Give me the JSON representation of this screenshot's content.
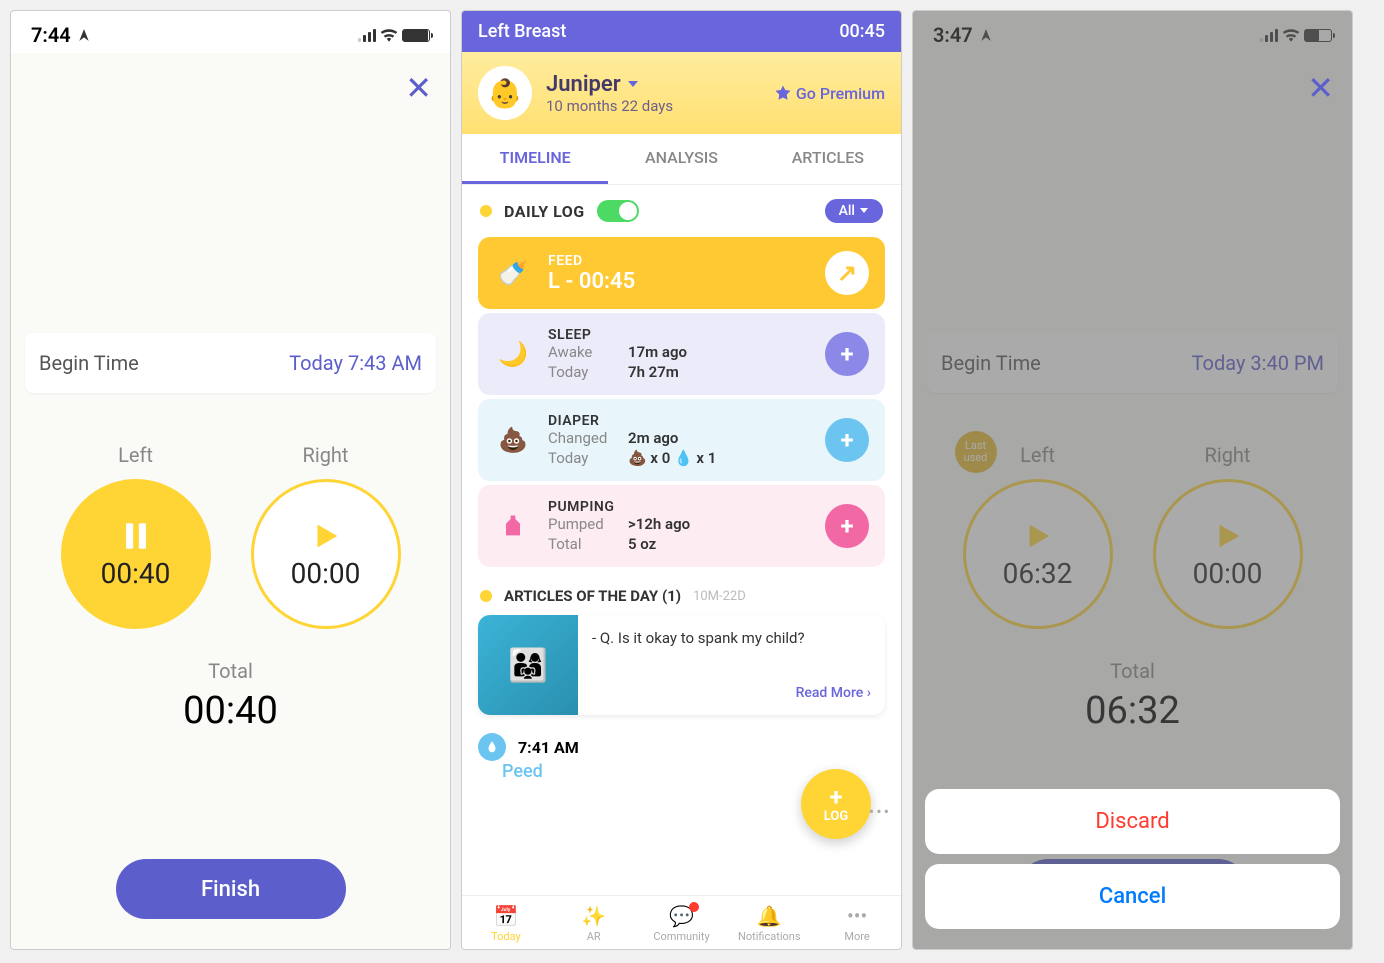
{
  "phone1": {
    "status_time": "7:44",
    "begin_label": "Begin Time",
    "begin_value": "Today 7:43 AM",
    "left_label": "Left",
    "right_label": "Right",
    "left_time": "00:40",
    "right_time": "00:00",
    "total_label": "Total",
    "total_time": "00:40",
    "finish": "Finish"
  },
  "phone2": {
    "header_title": "Left Breast",
    "header_time": "00:45",
    "profile_name": "Juniper",
    "profile_age": "10 months 22 days",
    "go_premium": "Go Premium",
    "tabs": {
      "timeline": "TIMELINE",
      "analysis": "ANALYSIS",
      "articles": "ARTICLES"
    },
    "daily_log": "DAILY LOG",
    "all": "All",
    "feed": {
      "title": "FEED",
      "main": "L - 00:45"
    },
    "sleep": {
      "title": "SLEEP",
      "l1": "Awake",
      "v1": "17m ago",
      "l2": "Today",
      "v2": "7h 27m"
    },
    "diaper": {
      "title": "DIAPER",
      "l1": "Changed",
      "v1": "2m ago",
      "l2": "Today",
      "v2": "💩 x 0   💧 x 1"
    },
    "pumping": {
      "title": "PUMPING",
      "l1": "Pumped",
      "v1": ">12h ago",
      "l2": "Total",
      "v2": "5 oz"
    },
    "articles_title": "ARTICLES OF THE DAY (1)",
    "articles_sub": "10M-22D",
    "article_q": "- Q. Is it okay to spank my child?",
    "read_more": "Read More ›",
    "log_fab": "LOG",
    "tl_time": "7:41 AM",
    "tl_action": "Peed",
    "tabbar": {
      "today": "Today",
      "ar": "AR",
      "community": "Community",
      "notifications": "Notifications",
      "more": "More"
    }
  },
  "phone3": {
    "status_time": "3:47",
    "begin_label": "Begin Time",
    "begin_value": "Today 3:40 PM",
    "left_label": "Left",
    "right_label": "Right",
    "left_time": "06:32",
    "right_time": "00:00",
    "last_used": "Last used",
    "total_label": "Total",
    "total_time": "06:32",
    "discard": "Discard",
    "cancel": "Cancel"
  }
}
